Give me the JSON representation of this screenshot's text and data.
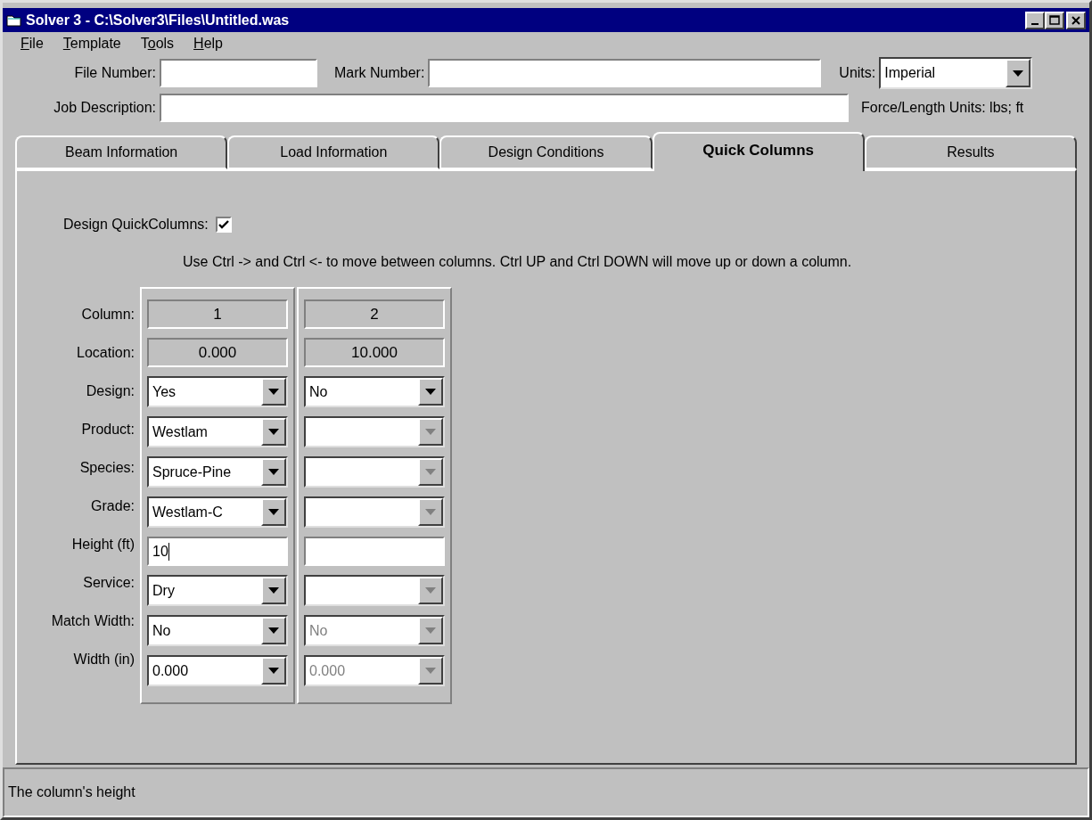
{
  "window": {
    "title": "Solver 3 - C:\\Solver3\\Files\\Untitled.was"
  },
  "menu": [
    {
      "key": "F",
      "post": "ile"
    },
    {
      "key": "T",
      "post": "emplate"
    },
    {
      "pre": "T",
      "key": "o",
      "post": "ols"
    },
    {
      "key": "H",
      "post": "elp"
    }
  ],
  "header": {
    "file_number": {
      "label": "File Number:"
    },
    "mark_number": {
      "label": "Mark Number:"
    },
    "units": {
      "label": "Units:",
      "value": "Imperial"
    },
    "job_description": {
      "label": "Job Description:"
    },
    "force_length_units": "Force/Length Units: lbs; ft"
  },
  "tabs": [
    {
      "label": "Beam Information",
      "selected": false
    },
    {
      "label": "Load Information",
      "selected": false
    },
    {
      "label": "Design Conditions",
      "selected": false
    },
    {
      "label": "Quick Columns",
      "selected": true
    },
    {
      "label": "Results",
      "selected": false
    }
  ],
  "design_quick_columns": {
    "label": "Design QuickColumns:",
    "checked": true
  },
  "instructions": "Use Ctrl -> and Ctrl <- to move between columns. Ctrl UP and Ctrl DOWN will move up or down a column.",
  "grid": {
    "row_labels": [
      "Column:",
      "Location:",
      "Design:",
      "Product:",
      "Species:",
      "Grade:",
      "Height (ft)",
      "Service:",
      "Match Width:",
      "Width (in)"
    ],
    "columns": [
      {
        "cells": [
          {
            "kind": "readonly",
            "value": "1"
          },
          {
            "kind": "readonly",
            "value": "0.000"
          },
          {
            "kind": "select",
            "value": "Yes",
            "disabled": false
          },
          {
            "kind": "select",
            "value": "Westlam",
            "disabled": false
          },
          {
            "kind": "select",
            "value": "Spruce-Pine",
            "disabled": false
          },
          {
            "kind": "select",
            "value": "Westlam-C",
            "disabled": false
          },
          {
            "kind": "text",
            "value": "10",
            "focused": true
          },
          {
            "kind": "select",
            "value": "Dry",
            "disabled": false
          },
          {
            "kind": "select",
            "value": "No",
            "disabled": false
          },
          {
            "kind": "select",
            "value": "0.000",
            "disabled": false
          }
        ]
      },
      {
        "cells": [
          {
            "kind": "readonly",
            "value": "2"
          },
          {
            "kind": "readonly",
            "value": "10.000"
          },
          {
            "kind": "select",
            "value": "No",
            "disabled": false
          },
          {
            "kind": "select",
            "disabled": true
          },
          {
            "kind": "select",
            "disabled": true
          },
          {
            "kind": "select",
            "disabled": true
          },
          {
            "kind": "text",
            "focused": false
          },
          {
            "kind": "select",
            "disabled": true
          },
          {
            "kind": "select",
            "value": "No",
            "disabled": true
          },
          {
            "kind": "select",
            "value": "0.000",
            "disabled": true
          }
        ]
      }
    ]
  },
  "status_bar": "The column's height"
}
